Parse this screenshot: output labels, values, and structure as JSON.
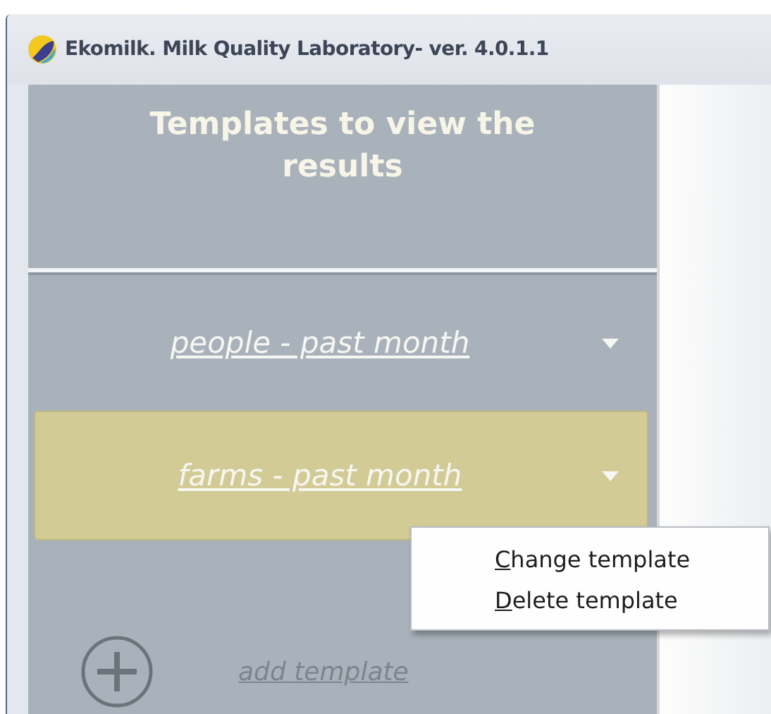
{
  "window": {
    "title": "Ekomilk. Milk Quality Laboratory- ver. 4.0.1.1"
  },
  "sidebar": {
    "heading": "Templates to view the results",
    "templates": [
      {
        "label": "people - past month",
        "selected": false
      },
      {
        "label": "farms - past month",
        "selected": true
      }
    ],
    "add_template": {
      "label": "add template"
    }
  },
  "context_menu": {
    "items": [
      {
        "access_key": "C",
        "rest": "hange template"
      },
      {
        "access_key": "D",
        "rest": "elete template"
      }
    ]
  }
}
